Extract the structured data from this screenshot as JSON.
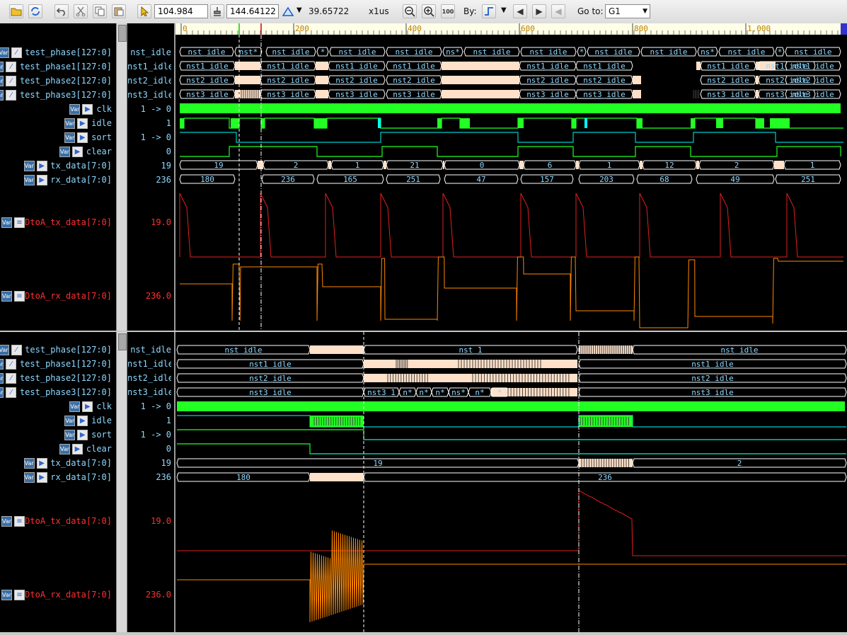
{
  "toolbar": {
    "cursor_time": "104.984",
    "marker_time": "144.64122",
    "delta_time": "39.65722",
    "unit": "x1us",
    "by_label": "By:",
    "goto_label": "Go to:",
    "goto_value": "G1"
  },
  "ruler": {
    "ticks": [
      "0",
      "200",
      "400",
      "600",
      "800",
      "1,000"
    ]
  },
  "top_pane": {
    "signals": [
      {
        "name": "test_phase[127:0]",
        "value": "nst_idle",
        "icon": "bus-icon"
      },
      {
        "name": "test_phase1[127:0]",
        "value": "nst1_idle",
        "icon": "bus-icon"
      },
      {
        "name": "test_phase2[127:0]",
        "value": "nst2_idle",
        "icon": "bus-icon"
      },
      {
        "name": "test_phase3[127:0]",
        "value": "nst3_idle",
        "icon": "bus-icon"
      },
      {
        "name": "clk",
        "value": "1 -> 0",
        "icon": "input-port-icon"
      },
      {
        "name": "idle",
        "value": "1",
        "icon": "output-port-icon"
      },
      {
        "name": "sort",
        "value": "1 -> 0",
        "icon": "input-port-icon"
      },
      {
        "name": "clear",
        "value": "0",
        "icon": "input-port-icon"
      },
      {
        "name": "tx_data[7:0]",
        "value": "19",
        "icon": "output-port-icon"
      },
      {
        "name": "rx_data[7:0]",
        "value": "236",
        "icon": "input-port-icon"
      }
    ],
    "analog": [
      {
        "name": "DtoA_tx_data[7:0]",
        "value": "19.0"
      },
      {
        "name": "DtoA_rx_data[7:0]",
        "value": "236.0"
      }
    ],
    "phase_labels": [
      "nst_idle",
      "nst*",
      "nst_idle",
      "*",
      "nst_idle",
      "nst_idle",
      "ns*",
      "nst_idle",
      "nst_idle",
      "*",
      "nst_idle",
      "nst_idle",
      "ns*",
      "nst_idle",
      "*",
      "nst_idle"
    ],
    "phase1_labels": [
      "nst1_idle",
      "nst1_idle",
      "nst1_idle",
      "nst1_idle",
      "nst1_idle",
      "nst1_idle",
      "nst1_idle",
      "nst1_idle",
      "nst1_idle",
      "nst1_idle",
      "nst1_idle"
    ],
    "phase2_labels": [
      "nst2_idle",
      "nst2_idle",
      "nst2_idle",
      "nst2_idle",
      "nst2_idle",
      "nst2_idle",
      "nst2_idle",
      "nst2_idle",
      "nst2_idle",
      "nst2_idle",
      "nst2_idle"
    ],
    "phase3_labels": [
      "nst3_idle",
      "nst3_idle",
      "nst3_idle",
      "nst3_idle",
      "nst3_idle",
      "nst3_idle",
      "nst3_idle",
      "nst3_idle",
      "nst3_idle",
      "nst3_idle",
      "nst3_idle"
    ],
    "tx_values": [
      "19",
      "2",
      "1",
      "21",
      "0",
      "6",
      "1",
      "12",
      "2",
      "1"
    ],
    "rx_values": [
      "180",
      "236",
      "165",
      "251",
      "47",
      "157",
      "203",
      "68",
      "49",
      "251"
    ]
  },
  "bottom_pane": {
    "signals": [
      {
        "name": "test_phase[127:0]",
        "value": "nst_idle",
        "icon": "bus-icon"
      },
      {
        "name": "test_phase1[127:0]",
        "value": "nst1_idle",
        "icon": "bus-icon"
      },
      {
        "name": "test_phase2[127:0]",
        "value": "nst2_idle",
        "icon": "bus-icon"
      },
      {
        "name": "test_phase3[127:0]",
        "value": "nst3_idle",
        "icon": "bus-icon"
      },
      {
        "name": "clk",
        "value": "1 -> 0",
        "icon": "input-port-icon"
      },
      {
        "name": "idle",
        "value": "1",
        "icon": "output-port-icon"
      },
      {
        "name": "sort",
        "value": "1 -> 0",
        "icon": "input-port-icon"
      },
      {
        "name": "clear",
        "value": "0",
        "icon": "input-port-icon"
      },
      {
        "name": "tx_data[7:0]",
        "value": "19",
        "icon": "output-port-icon"
      },
      {
        "name": "rx_data[7:0]",
        "value": "236",
        "icon": "input-port-icon"
      }
    ],
    "analog": [
      {
        "name": "DtoA_tx_data[7:0]",
        "value": "19.0"
      },
      {
        "name": "DtoA_rx_data[7:0]",
        "value": "236.0"
      }
    ],
    "phase_labels": [
      "nst_idle",
      "nst_1",
      "nst_idle"
    ],
    "phase1_labels": [
      "nst1_idle",
      "nst1_idle"
    ],
    "phase2_labels": [
      "nst2_idle",
      "nst2_idle"
    ],
    "phase3_labels": [
      "nst3_idle",
      "nst3_1",
      "n*",
      "n*",
      "n*",
      "ns*",
      "n*",
      "*",
      "nst3_idle"
    ],
    "tx_values": [
      "19",
      "2"
    ],
    "rx_values": [
      "180",
      "236"
    ]
  },
  "colors": {
    "background": "#000000",
    "digital": "#22ff22",
    "analog_tx": "#e02020",
    "analog_rx": "#ff8800",
    "bus_fill": "#ffe0c8",
    "signal_name": "#8fd8ff"
  }
}
